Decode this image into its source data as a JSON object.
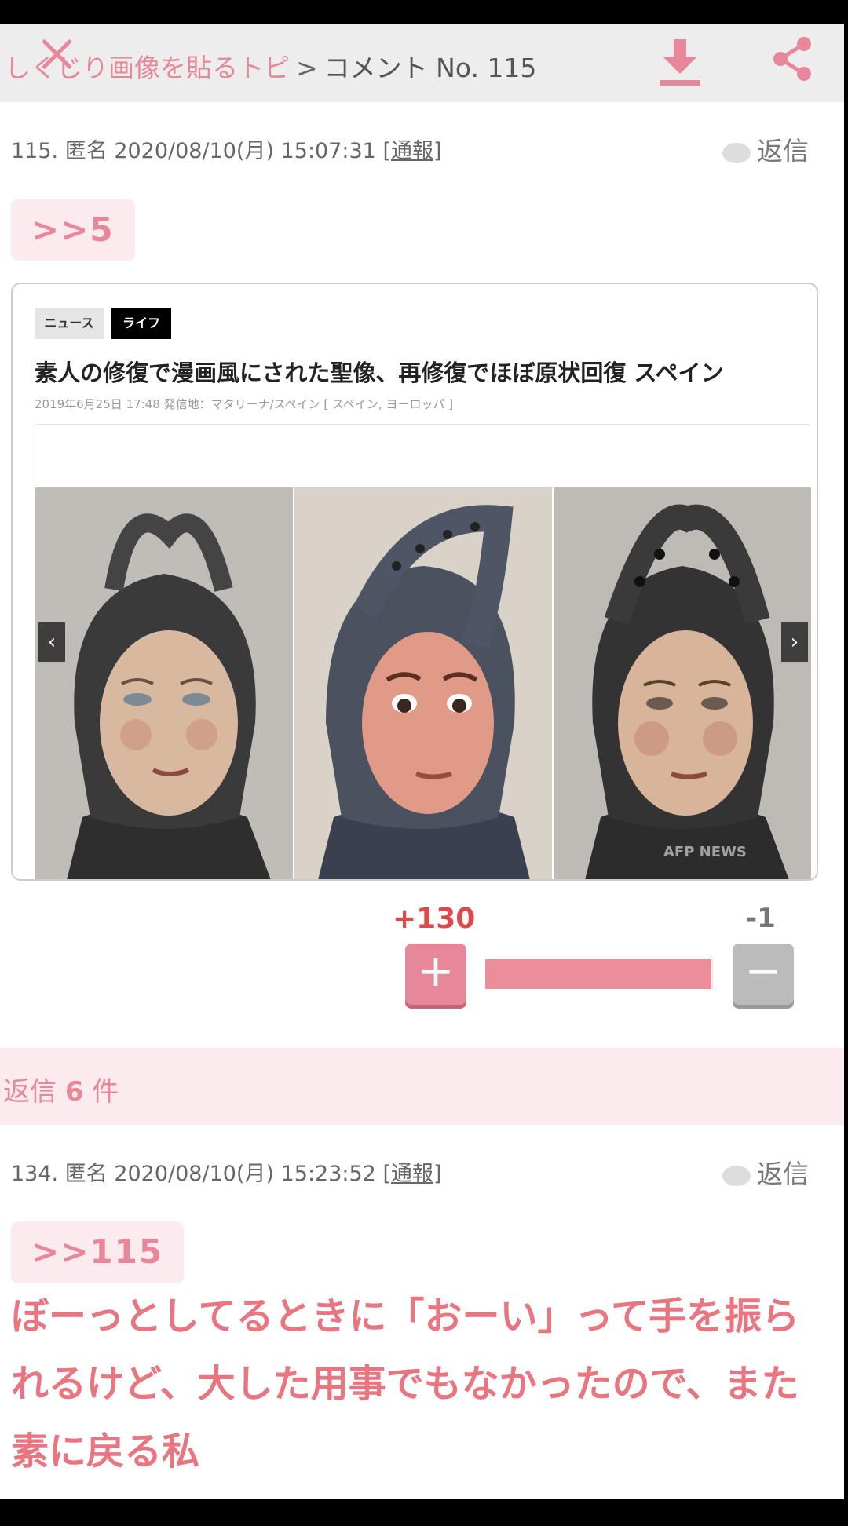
{
  "header": {
    "breadcrumb_topic": "しくじり画像を貼るトピ",
    "breadcrumb_separator": ">",
    "breadcrumb_current": "コメント No. 115"
  },
  "comment": {
    "number": "115.",
    "author": "匿名",
    "datetime": "2020/08/10(月) 15:07:31",
    "report_label": "通報",
    "reply_label": "返信",
    "anchor": ">>5",
    "votes": {
      "plus": "+130",
      "minus": "-1",
      "plus_share": 0.992
    }
  },
  "news_card": {
    "tags": [
      "ニュース",
      "ライフ"
    ],
    "title": "素人の修復で漫画風にされた聖像、再修復でほぼ原状回復 スペイン",
    "date_line": "2019年6月25日 17:48  発信地：マタリーナ/スペイン [ スペイン, ヨーロッパ ]",
    "photo_credit": "AFP NEWS"
  },
  "replies": {
    "prefix": "返信",
    "count": "6",
    "suffix": "件"
  },
  "reply": {
    "number": "134.",
    "author": "匿名",
    "datetime": "2020/08/10(月) 15:23:52",
    "report_label": "通報",
    "reply_label": "返信",
    "anchor": ">>115",
    "body": "ぼーっとしてるときに「おーい」って手を振られるけど、大した用事でもなかったので、また素に戻る私"
  },
  "colors": {
    "accent": "#e8879a",
    "vote_plus_text": "#d94a4a",
    "band": "#fbeaee",
    "reply_text": "#e8757f"
  }
}
